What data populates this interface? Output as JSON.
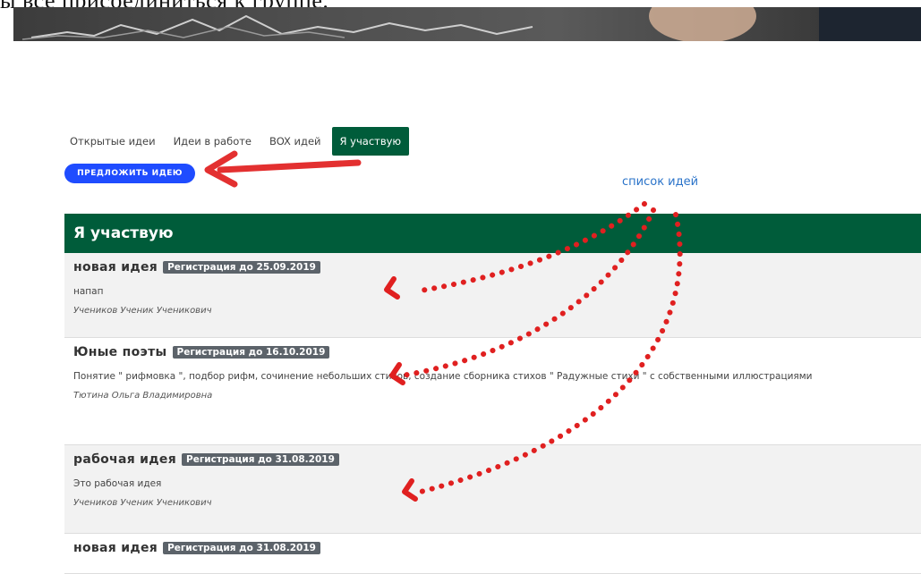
{
  "doc": {
    "top_text": "ы все присоединиться к группе."
  },
  "tabs": [
    {
      "label": "Открытые идеи"
    },
    {
      "label": "Идеи в работе"
    },
    {
      "label": "BOX идей"
    },
    {
      "label": "Я участвую"
    }
  ],
  "propose_button": {
    "label": "ПРЕДЛОЖИТЬ ИДЕЮ"
  },
  "annotation": {
    "label": "список идей"
  },
  "list": {
    "header": "Я участвую",
    "items": [
      {
        "title": "новая идея",
        "badge": "Регистрация до 25.09.2019",
        "desc": "напап",
        "author": "Учеников Ученик Ученикович"
      },
      {
        "title": "Юные поэты",
        "badge": "Регистрация до 16.10.2019",
        "desc": "Понятие \" рифмовка \", подбор рифм, сочинение небольших стихов, создание сборника стихов \" Радужные стихи \" с собственными иллюстрациями",
        "author": "Тютина Ольга Владимировна"
      },
      {
        "title": "рабочая идея",
        "badge": "Регистрация до 31.08.2019",
        "desc": "Это рабочая идея",
        "author": "Учеников Ученик Ученикович"
      },
      {
        "title": "новая идея",
        "badge": "Регистрация до 31.08.2019"
      }
    ]
  },
  "colors": {
    "accent_green": "#005c3a",
    "button_blue": "#1f4cff",
    "badge_gray": "#5c636a",
    "arrow_red": "#e33030",
    "annotation_blue": "#2a73c9"
  }
}
